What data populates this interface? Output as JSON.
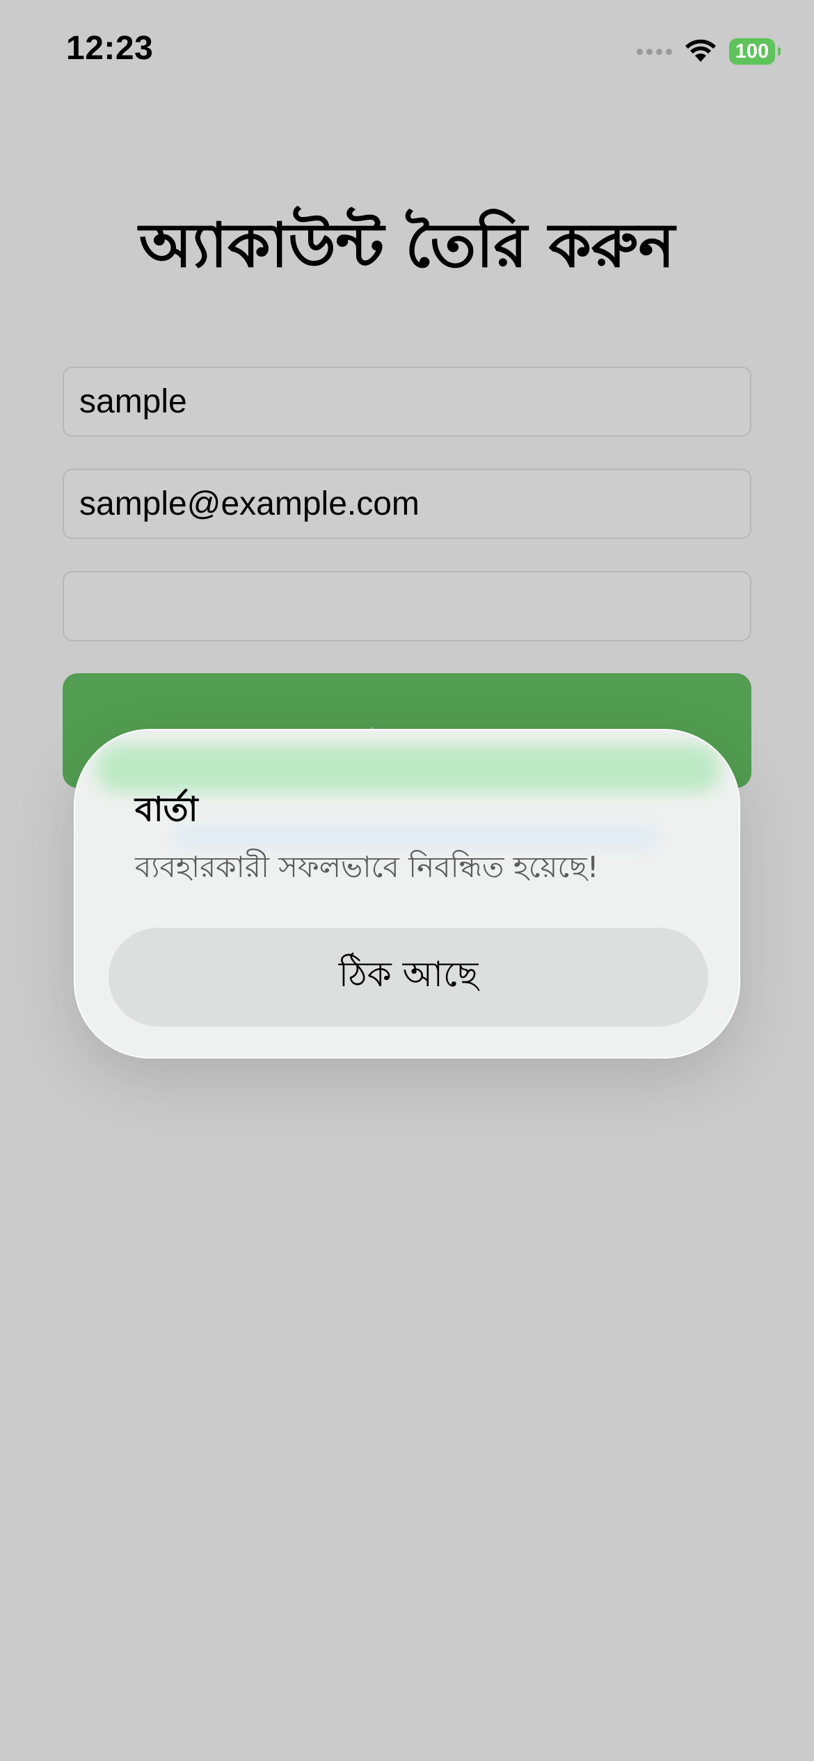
{
  "status_bar": {
    "time": "12:23",
    "battery": "100",
    "signal_icon": "signal-dots-icon",
    "wifi_icon": "wifi-icon"
  },
  "page": {
    "title": "অ্যাকাউন্ট তৈরি করুন"
  },
  "form": {
    "name_value": "sample",
    "email_value": "sample@example.com",
    "password_value": "",
    "signup_label": "সাইন আপ"
  },
  "alert": {
    "title": "বার্তা",
    "message": "ব্যবহারকারী সফলভাবে নিবন্ধিত হয়েছে!",
    "ok_label": "ঠিক আছে"
  },
  "colors": {
    "background": "#cbcbcb",
    "signup_button": "#529d51",
    "battery": "#5fc35b",
    "alert_background": "#eff1f0"
  }
}
